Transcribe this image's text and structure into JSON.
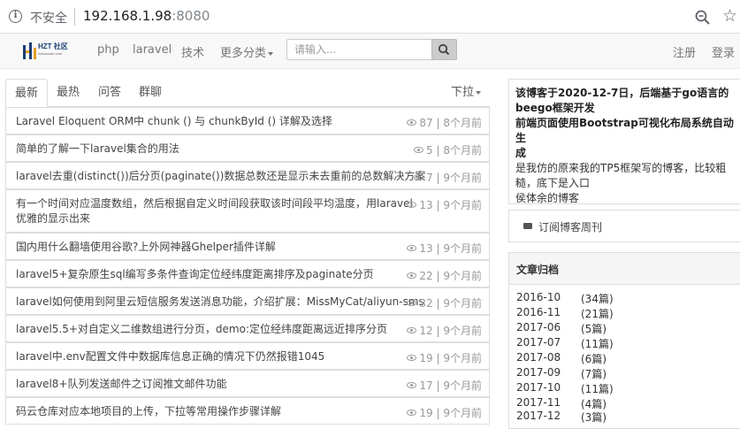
{
  "browser": {
    "insecure_label": "不安全",
    "url_host": "192.168.1.98",
    "url_port": ":8080"
  },
  "navbar": {
    "logo_text": "HZT 社区",
    "logo_sub": "hztoncode.com",
    "links": [
      "php",
      "laravel",
      "技术",
      "更多分类"
    ],
    "search_placeholder": "请输入...",
    "register": "注册",
    "login": "登录"
  },
  "tabs": {
    "items": [
      "最新",
      "最热",
      "问答",
      "群聊"
    ],
    "dropdown": "下拉"
  },
  "articles": [
    {
      "title": "Laravel Eloquent ORM中 chunk () 与 chunkById () 详解及选择",
      "views": "87",
      "time": "8个月前"
    },
    {
      "title": "简单的了解一下laravel集合的用法",
      "views": "5",
      "time": "8个月前"
    },
    {
      "title": "laravel去重(distinct())后分页(paginate())数据总数还是显示未去重前的总数解决方案",
      "views": "7",
      "time": "9个月前"
    },
    {
      "title": "有一个时间对应温度数组，然后根据自定义时间段获取该时间段平均温度，用laravel",
      "title2": "优雅的显示出来",
      "views": "13",
      "time": "9个月前"
    },
    {
      "title": "国内用什么翻墙使用谷歌?上外网神器Ghelper插件详解",
      "views": "13",
      "time": "9个月前"
    },
    {
      "title": "laravel5+复杂原生sql编写多条件查询定位经纬度距离排序及paginate分页",
      "views": "22",
      "time": "9个月前"
    },
    {
      "title": "laravel如何使用到阿里云短信服务发送消息功能，介绍扩展：MissMyCat/aliyun-sms",
      "views": "32",
      "time": "9个月前"
    },
    {
      "title": "laravel5.5+对自定义二维数组进行分页，demo:定位经纬度距离远近排序分页",
      "views": "12",
      "time": "9个月前"
    },
    {
      "title": "laravel中.env配置文件中数据库信息正确的情况下仍然报错1045",
      "views": "19",
      "time": "9个月前"
    },
    {
      "title": "laravel8+队列发送邮件之订阅推文邮件功能",
      "views": "17",
      "time": "9个月前"
    },
    {
      "title": "码云仓库对应本地项目的上传，下拉等常用操作步骤详解",
      "views": "19",
      "time": "9个月前"
    }
  ],
  "about": {
    "line1": "该博客于2020-12-7日，后端基于go语言的",
    "line2": "beego框架开发",
    "line3": "前端页面使用Bootstrap可视化布局系统自动生",
    "line4": "成",
    "line5": "是我仿的原来我的TP5框架写的博客，比较粗",
    "line6": "糙，底下是入口",
    "line7": "侯体余的博客"
  },
  "subscribe": {
    "label": "订阅博客周刊"
  },
  "archive": {
    "title": "文章归档",
    "items": [
      {
        "month": "2016-10",
        "count": "(34篇)"
      },
      {
        "month": "2016-11",
        "count": "(21篇)"
      },
      {
        "month": "2017-06",
        "count": "(5篇)"
      },
      {
        "month": "2017-07",
        "count": "(11篇)"
      },
      {
        "month": "2017-08",
        "count": "(6篇)"
      },
      {
        "month": "2017-09",
        "count": "(7篇)"
      },
      {
        "month": "2017-10",
        "count": "(11篇)"
      },
      {
        "month": "2017-11",
        "count": "(4篇)"
      },
      {
        "month": "2017-12",
        "count": "(3篇)"
      }
    ]
  }
}
